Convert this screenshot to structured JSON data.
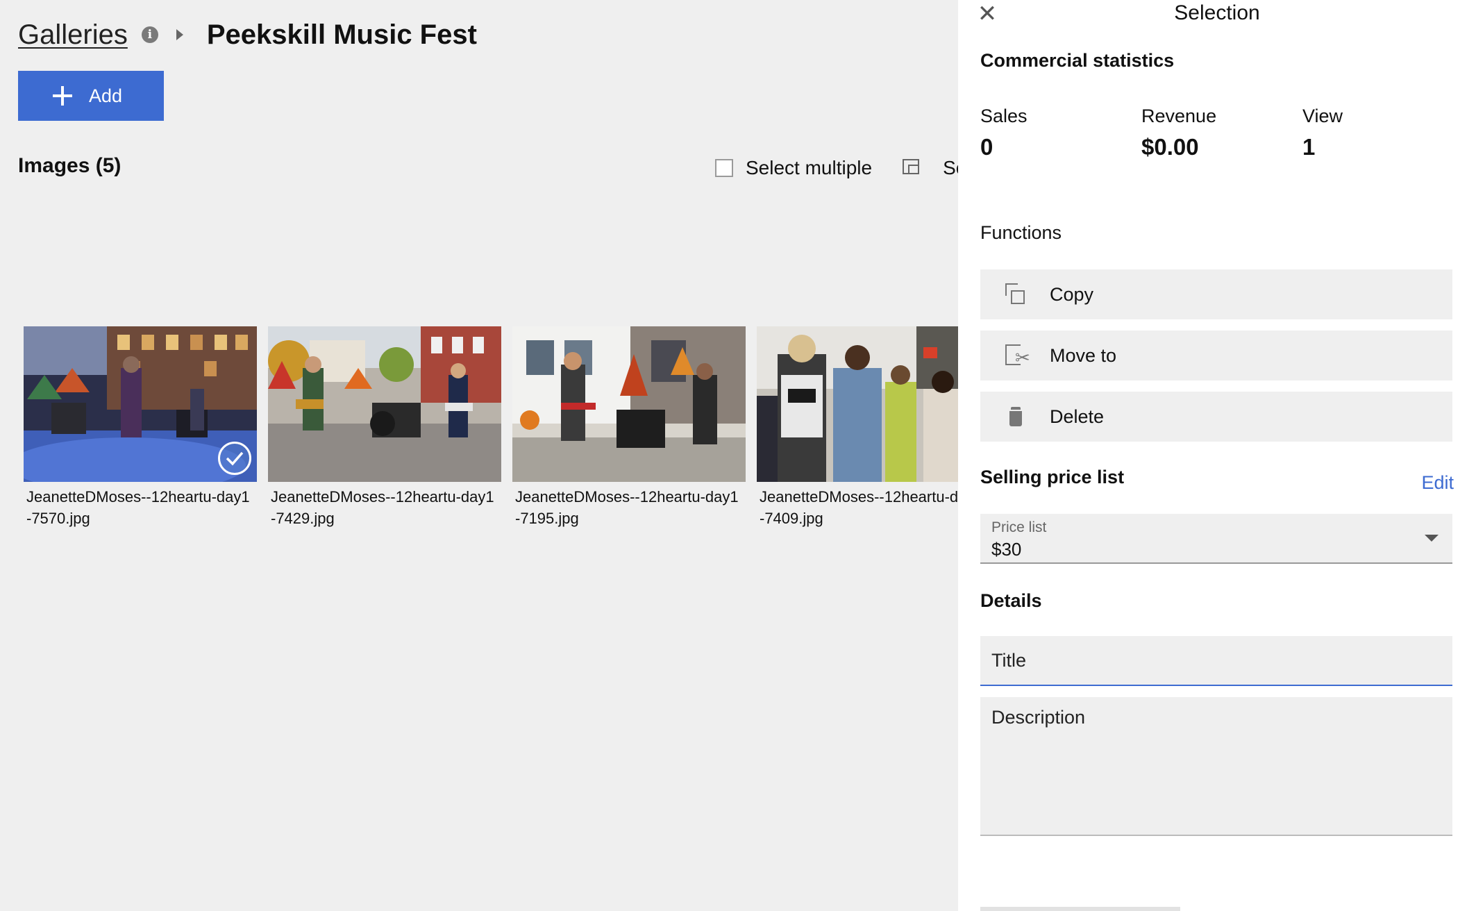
{
  "breadcrumb": {
    "parent": "Galleries",
    "current": "Peekskill Music Fest"
  },
  "toolbar": {
    "add_label": "Add",
    "select_multiple_label": "Select multiple",
    "truncated_label": "Se"
  },
  "images": {
    "heading": "Images (5)",
    "items": [
      {
        "name_line1": "JeanetteDMoses--12heartu-day1",
        "name_line2": "-7570.jpg",
        "selected": true
      },
      {
        "name_line1": "JeanetteDMoses--12heartu-day1",
        "name_line2": "-7429.jpg",
        "selected": false
      },
      {
        "name_line1": "JeanetteDMoses--12heartu-day1",
        "name_line2": "-7195.jpg",
        "selected": false
      },
      {
        "name_line1": "JeanetteDMoses--12heartu-day1",
        "name_line2": "-7409.jpg",
        "selected": false
      }
    ]
  },
  "panel": {
    "title": "Selection",
    "commercial_heading": "Commercial statistics",
    "stats": [
      {
        "label": "Sales",
        "value": "0"
      },
      {
        "label": "Revenue",
        "value": "$0.00"
      },
      {
        "label": "View",
        "value": "1"
      }
    ],
    "functions_label": "Functions",
    "functions": [
      {
        "label": "Copy",
        "icon": "copy-icon"
      },
      {
        "label": "Move to",
        "icon": "move-icon"
      },
      {
        "label": "Delete",
        "icon": "trash-icon"
      }
    ],
    "price_heading": "Selling price list",
    "edit_label": "Edit",
    "price_list": {
      "caption": "Price list",
      "value": "$30"
    },
    "details_heading": "Details",
    "title_placeholder": "Title",
    "description_placeholder": "Description"
  },
  "colors": {
    "accent": "#3d6bd1",
    "background": "#efefef",
    "panel": "#ffffff"
  }
}
